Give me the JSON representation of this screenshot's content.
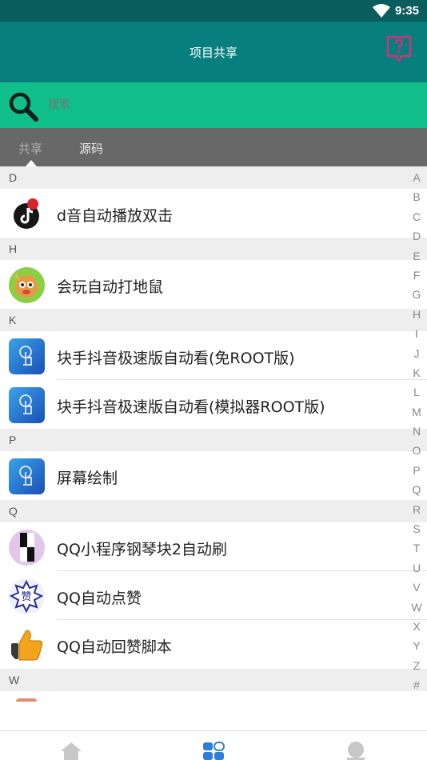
{
  "status": {
    "time": "9:35"
  },
  "appbar": {
    "title": "项目共享",
    "help_icon": "help-icon"
  },
  "search": {
    "placeholder": "搜索"
  },
  "tabs": [
    {
      "label": "共享"
    },
    {
      "label": "源码"
    }
  ],
  "sections": [
    {
      "letter": "D",
      "items": [
        {
          "label": "d音自动播放双击",
          "icon": "tiktok-icon"
        }
      ]
    },
    {
      "letter": "H",
      "items": [
        {
          "label": "会玩自动打地鼠",
          "icon": "game-character-icon"
        }
      ]
    },
    {
      "letter": "K",
      "items": [
        {
          "label": "块手抖音极速版自动看(免ROOT版)",
          "icon": "touch-app-icon"
        },
        {
          "label": "块手抖音极速版自动看(模拟器ROOT版)",
          "icon": "touch-app-icon"
        }
      ]
    },
    {
      "letter": "P",
      "items": [
        {
          "label": "屏幕绘制",
          "icon": "touch-app-icon"
        }
      ]
    },
    {
      "letter": "Q",
      "items": [
        {
          "label": "QQ小程序钢琴块2自动刷",
          "icon": "piano-tiles-icon"
        },
        {
          "label": "QQ自动点赞",
          "icon": "like-badge-icon"
        },
        {
          "label": "QQ自动回赞脚本",
          "icon": "thumbs-up-icon"
        }
      ]
    },
    {
      "letter": "W",
      "items": []
    }
  ],
  "alphabet": [
    "A",
    "B",
    "C",
    "D",
    "E",
    "F",
    "G",
    "H",
    "I",
    "J",
    "K",
    "L",
    "M",
    "N",
    "O",
    "P",
    "Q",
    "R",
    "S",
    "T",
    "U",
    "V",
    "W",
    "X",
    "Y",
    "Z",
    "#"
  ],
  "bottom_nav": [
    {
      "icon": "home-icon"
    },
    {
      "icon": "grid-apps-icon"
    },
    {
      "icon": "user-icon"
    }
  ],
  "colors": {
    "statusbar": "#0a5d5d",
    "appbar": "#077f7f",
    "search": "#10bf89",
    "tabs": "#696869",
    "active_nav": "#2f7ddb"
  }
}
